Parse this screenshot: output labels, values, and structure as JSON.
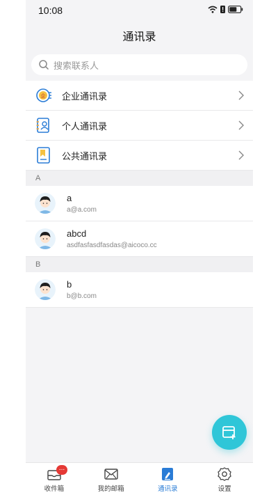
{
  "status": {
    "time": "10:08"
  },
  "header": {
    "title": "通讯录"
  },
  "search": {
    "placeholder": "搜索联系人"
  },
  "menu": [
    {
      "label": "企业通讯录",
      "icon": "enterprise-icon"
    },
    {
      "label": "个人通讯录",
      "icon": "personal-contacts-icon"
    },
    {
      "label": "公共通讯录",
      "icon": "public-contacts-icon"
    }
  ],
  "sections": [
    {
      "letter": "A",
      "contacts": [
        {
          "name": "a",
          "email": "a@a.com"
        },
        {
          "name": "abcd",
          "email": "asdfasfasdfasdas@aicoco.cc"
        }
      ]
    },
    {
      "letter": "B",
      "contacts": [
        {
          "name": "b",
          "email": "b@b.com"
        }
      ]
    }
  ],
  "tabs": [
    {
      "label": "收件箱",
      "badge": "...",
      "icon": "inbox-icon"
    },
    {
      "label": "我的邮箱",
      "icon": "mailbox-icon"
    },
    {
      "label": "通讯录",
      "icon": "contacts-icon",
      "active": true
    },
    {
      "label": "设置",
      "icon": "settings-icon"
    }
  ],
  "colors": {
    "accent": "#2a7cd6",
    "fab": "#2fc6d8",
    "badge": "#e53935"
  }
}
